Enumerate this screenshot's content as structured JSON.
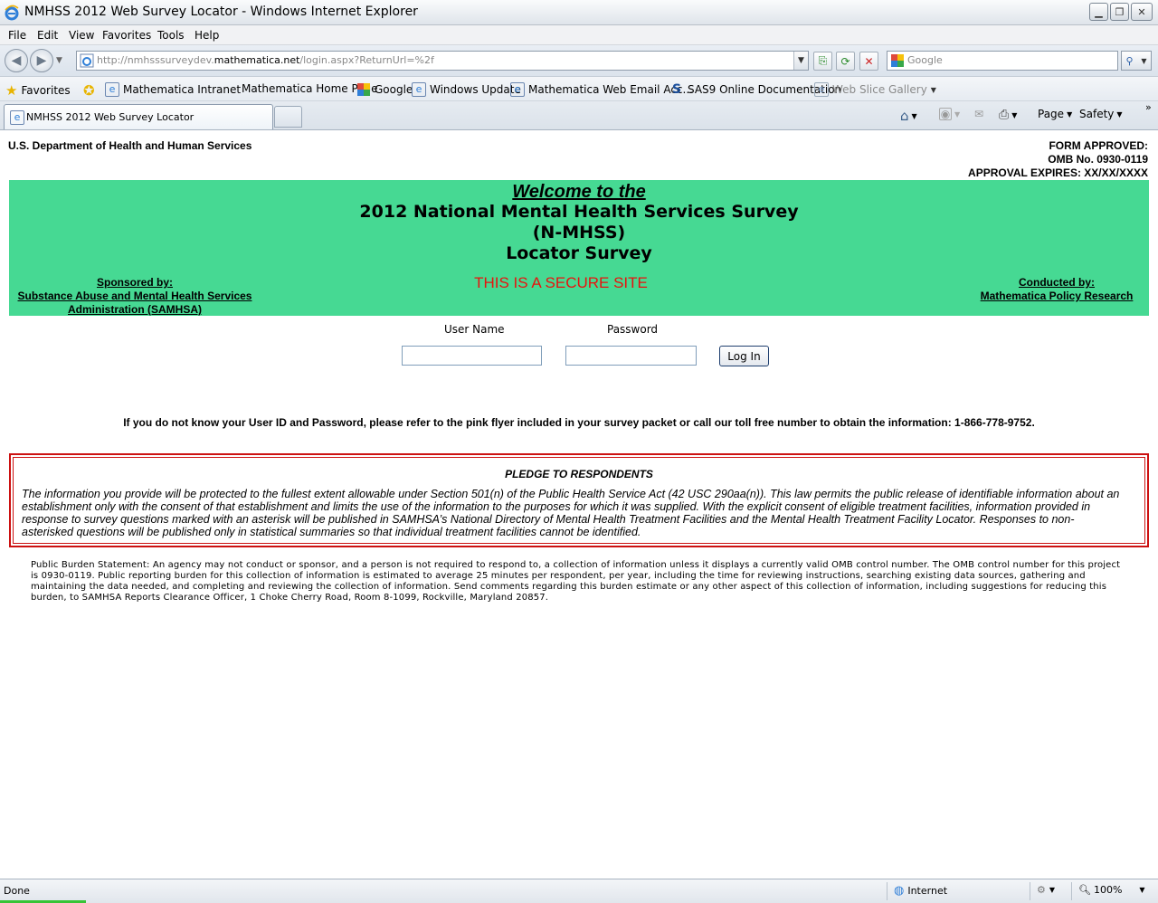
{
  "window": {
    "title": "NMHSS 2012 Web Survey Locator - Windows Internet Explorer"
  },
  "menu": {
    "items": [
      "File",
      "Edit",
      "View",
      "Favorites",
      "Tools",
      "Help"
    ]
  },
  "address": {
    "url_prefix": "http://nmhsssurveydev.",
    "url_domain": "mathematica.net",
    "url_suffix": "/login.aspx?ReturnUrl=%2f",
    "search_placeholder": "Google"
  },
  "favorites": {
    "label": "Favorites",
    "items": [
      "Mathematica Intranet",
      "Mathematica Home Page",
      "Google",
      "Windows Update",
      "Mathematica Web Email Acc...",
      "SAS9 Online Documentation",
      "Web Slice Gallery"
    ]
  },
  "tabs": {
    "active": "NMHSS 2012 Web Survey Locator"
  },
  "commands": {
    "page": "Page",
    "safety": "Safety"
  },
  "page": {
    "department": "U.S. Department of Health and Human Services",
    "form_approved": "FORM APPROVED:",
    "omb_number": "OMB No. 0930-0119",
    "approval_expires": "APPROVAL EXPIRES: XX/XX/XXXX",
    "welcome": "Welcome to the",
    "survey_line1": "2012 National Mental Health Services Survey",
    "survey_line2": "(N-MHSS)",
    "survey_line3": "Locator Survey",
    "sponsored_by": "Sponsored by:",
    "sponsor_name": "Substance Abuse and Mental Health Services Administration (SAMHSA)",
    "secure_site": "THIS IS A SECURE SITE",
    "conducted_by": "Conducted by:",
    "conductor_name": "Mathematica Policy Research",
    "username_label": "User Name",
    "password_label": "Password",
    "username_value": "",
    "password_value": "",
    "login_label": "Log In",
    "info_line": "If you do not know your User ID and Password, please refer to the pink flyer included in your survey packet or call our toll free number to obtain the information: 1-866-778-9752.",
    "pledge_title": "PLEDGE TO RESPONDENTS",
    "pledge_text": "The information you provide will be protected to the fullest extent allowable under Section 501(n) of the Public Health Service Act (42 USC 290aa(n)). This law permits the public release of identifiable information about an establishment only with the consent of that establishment and limits the use of the information to the purposes for which it was supplied. With the explicit consent of eligible treatment facilities, information provided in response to survey questions marked with an asterisk will be published in SAMHSA’s National Directory of Mental Health Treatment Facilities and the Mental Health Treatment Facility Locator. Responses to non-asterisked questions will be published only in statistical summaries so that individual treatment facilities cannot be identified.",
    "burden_statement": "Public Burden Statement: An agency may not conduct or sponsor, and a person is not required to respond to, a collection of information unless it displays a currently valid OMB control number. The OMB control number for this project is 0930-0119. Public reporting burden for this collection of information is estimated to average 25 minutes per respondent, per year, including the time for reviewing instructions, searching existing data sources, gathering and maintaining the data needed, and completing and reviewing the collection of information. Send comments regarding this burden estimate or any other aspect of this collection of information, including suggestions for reducing this burden, to SAMHSA Reports Clearance Officer, 1 Choke Cherry Road, Room 8-1099, Rockville, Maryland 20857."
  },
  "status": {
    "text": "Done",
    "zone": "Internet",
    "zoom": "100%"
  },
  "colors": {
    "banner": "#46d993",
    "secure": "#e8120e",
    "pledge_border": "#cc1111"
  }
}
